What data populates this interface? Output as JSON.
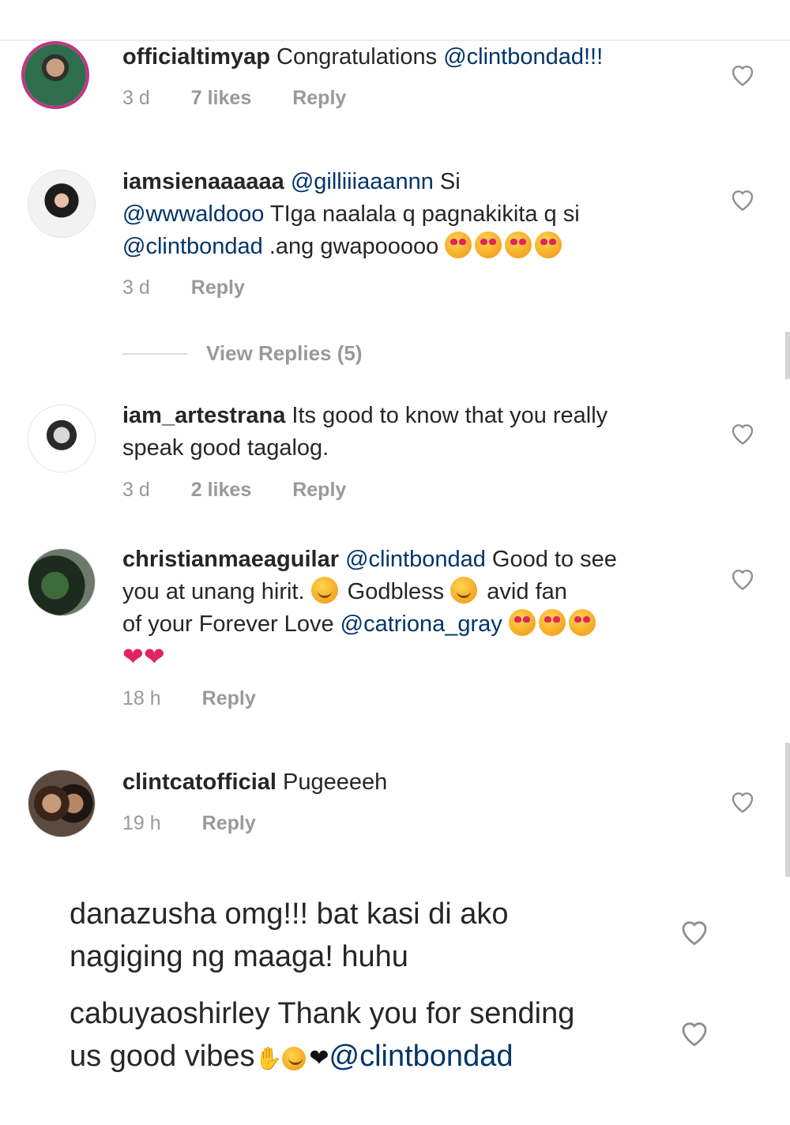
{
  "comments": [
    {
      "username": "officialtimyap",
      "text": " Congratulations ",
      "mention": "@clintbondad!!!",
      "time": "3 d",
      "likes": "7 likes",
      "reply": "Reply"
    },
    {
      "username": "iamsienaaaaaa",
      "mention1": "@gilliiiaaannn",
      "t1": "  Si",
      "mention2": "@wwwaldooo",
      "t2": "  TIga naalala q pagnakikita q si",
      "mention3": "@clintbondad",
      "t3": " .ang gwapooooo ",
      "time": "3 d",
      "reply": "Reply"
    },
    {
      "username": "iam_artestrana",
      "text": " Its good to know that you really",
      "text2": "speak good tagalog.",
      "time": "3 d",
      "likes": "2 likes",
      "reply": "Reply"
    },
    {
      "username": "christianmaeaguilar",
      "mention1": "@clintbondad",
      "t1": " Good to see",
      "t2": "you at unang hirit. ",
      "t3": " Godbless ",
      "t4": " avid fan",
      "t5": "of your Forever Love ",
      "mention2": "@catriona_gray",
      "hearts": "❤❤",
      "time": "18 h",
      "reply": "Reply"
    },
    {
      "username": "clintcatofficial",
      "text": " Pugeeeeh",
      "time": "19 h",
      "reply": "Reply"
    }
  ],
  "view_replies": "View Replies (5)",
  "extra_comments": [
    {
      "username": "danazusha",
      "text": " omg!!! bat kasi di ako",
      "text2": "nagiging ng maaga! huhu"
    },
    {
      "username": "cabuyaoshirley",
      "text": " Thank you for sending",
      "text2": "us good vibes",
      "blackheart": "❤",
      "mention": "@clintbondad"
    }
  ],
  "icons": {
    "heart": "heart-outline-icon",
    "emoji_love": "heart-eyes-emoji-icon",
    "emoji_laugh": "laughing-emoji-icon"
  },
  "colors": {
    "mention": "#003569",
    "meta": "#999999",
    "story_ring": "#c13584"
  }
}
